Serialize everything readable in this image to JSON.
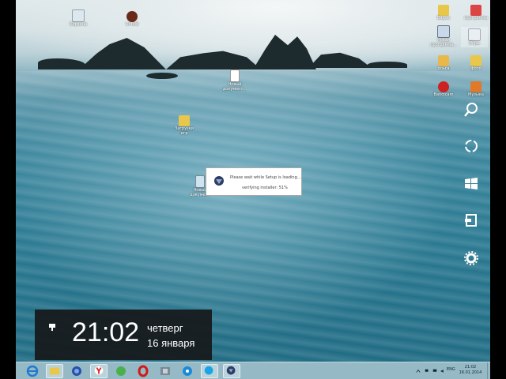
{
  "desktop_icons": [
    {
      "label": "Корзина"
    },
    {
      "label": "Unfold"
    },
    {
      "label": "Новый документ..."
    },
    {
      "label": "Загрузки игр"
    },
    {
      "label": "Новый документ"
    },
    {
      "label": "Видео"
    },
    {
      "label": "Новая программа..."
    },
    {
      "label": "ольга"
    },
    {
      "label": "Bandicam"
    },
    {
      "label": "программы"
    },
    {
      "label": "Игры"
    },
    {
      "label": "фото"
    },
    {
      "label": "Музыка"
    }
  ],
  "dialog": {
    "loading_text": "Please wait while Setup is loading...",
    "progress_text": "verifying installer: 51%",
    "progress_percent": 51
  },
  "clock_overlay": {
    "time": "21:02",
    "day": "четверг",
    "date": "16 января"
  },
  "charms": [
    {
      "name": "search-icon"
    },
    {
      "name": "share-icon"
    },
    {
      "name": "start-icon"
    },
    {
      "name": "devices-icon"
    },
    {
      "name": "settings-icon"
    }
  ],
  "taskbar": {
    "apps": [
      "internet-explorer",
      "file-explorer",
      "globe",
      "yandex",
      "utorrent",
      "opera",
      "game",
      "network",
      "skype",
      "setup"
    ],
    "lang": "ENG",
    "time": "21:02",
    "date": "16.01.2014"
  }
}
